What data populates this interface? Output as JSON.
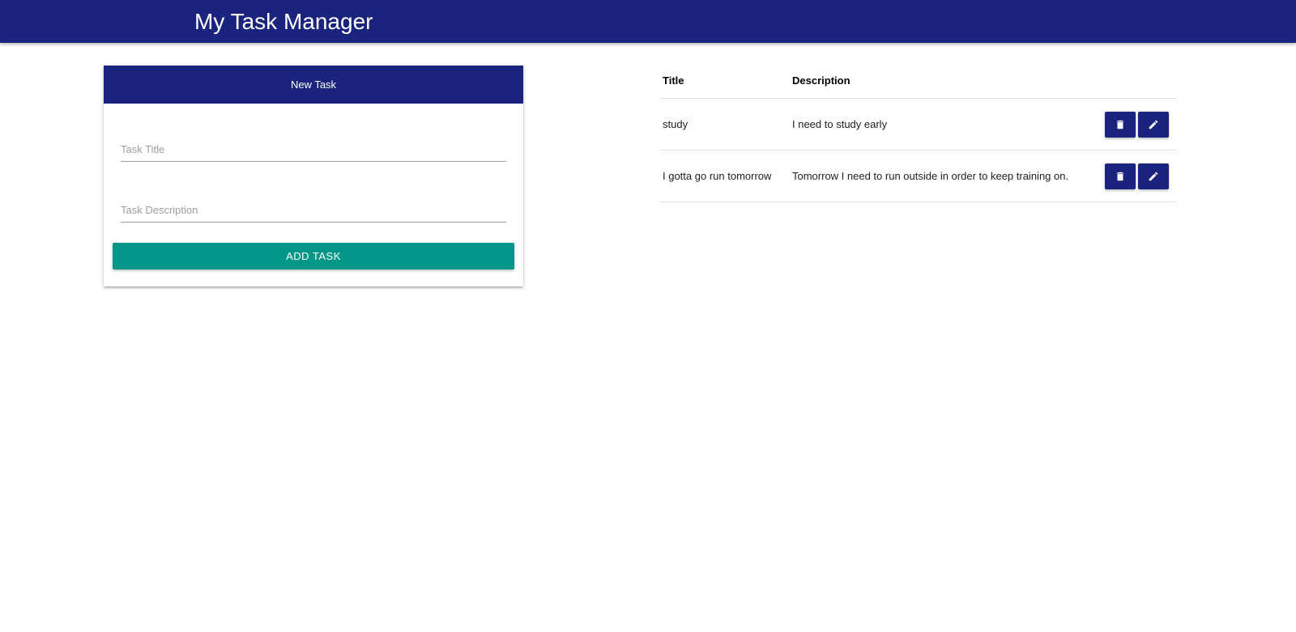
{
  "app": {
    "title": "My Task Manager",
    "primary_color": "#1a237e",
    "accent_color": "#009688"
  },
  "form": {
    "header": "New Task",
    "title_placeholder": "Task Title",
    "title_value": "",
    "description_placeholder": "Task Description",
    "description_value": "",
    "submit_label": "ADD TASK"
  },
  "table": {
    "columns": [
      "Title",
      "Description"
    ],
    "rows": [
      {
        "title": "study",
        "description": "I need to study early",
        "actions": [
          "trash-icon",
          "pencil-icon"
        ]
      },
      {
        "title": "I gotta go run tomorrow",
        "description": "Tomorrow I need to run outside in order to keep training on.",
        "actions": [
          "trash-icon",
          "pencil-icon"
        ]
      }
    ]
  }
}
